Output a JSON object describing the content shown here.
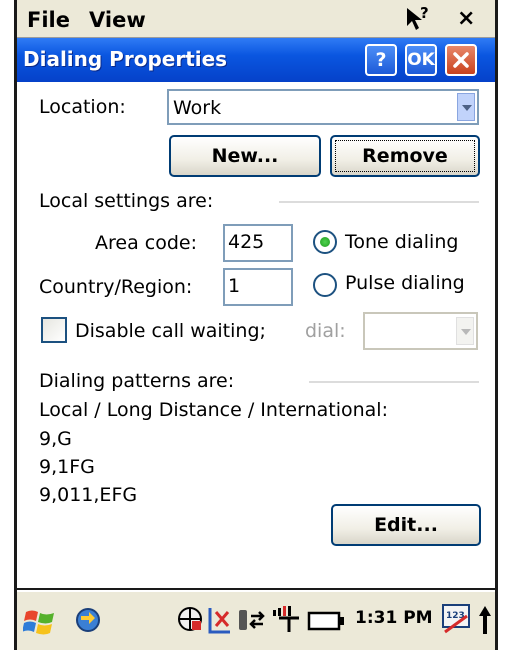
{
  "menubar": {
    "file": "File",
    "view": "View"
  },
  "dialog": {
    "title": "Dialing Properties",
    "help_btn": "?",
    "ok_btn": "OK",
    "location_label": "Location:",
    "location_value": "Work",
    "new_btn": "New...",
    "remove_btn": "Remove",
    "local_settings_label": "Local settings are:",
    "area_code_label": "Area code:",
    "area_code_value": "425",
    "country_label": "Country/Region:",
    "country_value": "1",
    "tone_label": "Tone dialing",
    "pulse_label": "Pulse dialing",
    "disable_call_waiting_label": "Disable call waiting;",
    "dial_label": "dial:",
    "patterns_label": "Dialing patterns are:",
    "patterns_header": "Local / Long Distance / International:",
    "pattern_local": "9,G",
    "pattern_long": "9,1FG",
    "pattern_intl": "9,011,EFG",
    "edit_btn": "Edit..."
  },
  "taskbar": {
    "time": "1:31 PM"
  },
  "colors": {
    "title_bar": "#0a56e0",
    "radio_selected": "#2fb52f",
    "close_button": "#d9542e"
  }
}
